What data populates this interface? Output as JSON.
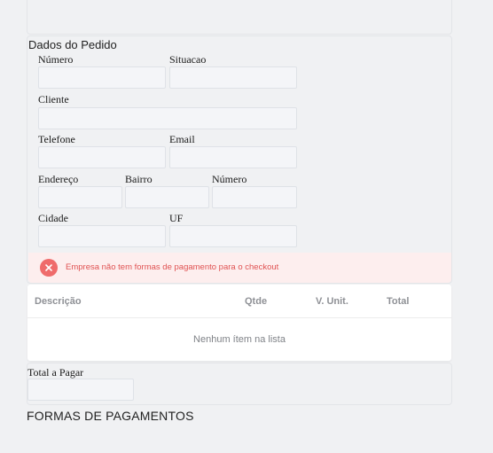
{
  "order": {
    "title": "Dados do Pedido",
    "fields": {
      "numero": {
        "label": "Número",
        "value": ""
      },
      "situacao": {
        "label": "Situacao",
        "value": ""
      },
      "cliente": {
        "label": "Cliente",
        "value": ""
      },
      "telefone": {
        "label": "Telefone",
        "value": ""
      },
      "email": {
        "label": "Email",
        "value": ""
      },
      "endereco": {
        "label": "Endereço",
        "value": ""
      },
      "bairro": {
        "label": "Bairro",
        "value": ""
      },
      "numero_endereco": {
        "label": "Número",
        "value": ""
      },
      "cidade": {
        "label": "Cidade",
        "value": ""
      },
      "uf": {
        "label": "UF",
        "value": ""
      }
    },
    "error": {
      "message": "Empresa não tem formas de pagamento para o checkout",
      "icon": "close-circle-icon",
      "color": "#ef6b6b"
    }
  },
  "items": {
    "columns": [
      "Descrição",
      "Qtde",
      "V. Unit.",
      "Total"
    ],
    "rows": [],
    "empty_message": "Nenhum ítem na lista"
  },
  "total": {
    "label": "Total a Pagar",
    "value": ""
  },
  "payments": {
    "title": "FORMAS DE PAGAMENTOS"
  }
}
